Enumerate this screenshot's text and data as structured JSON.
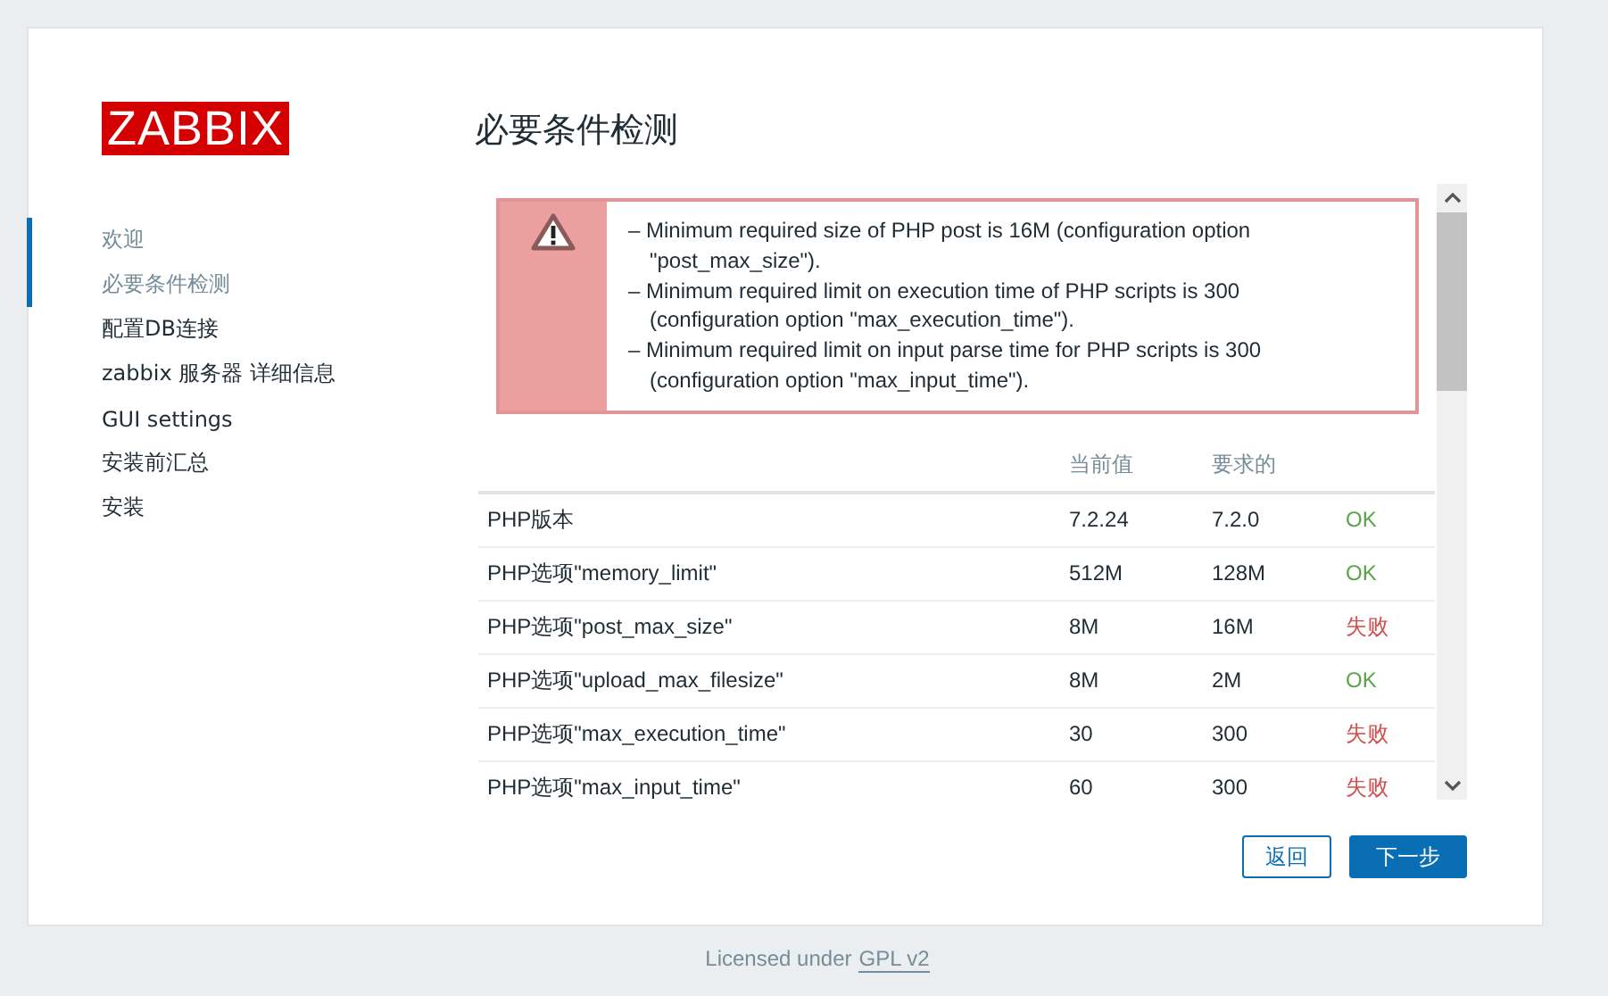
{
  "logo": "ZABBIX",
  "steps": [
    {
      "label": "欢迎",
      "done": true
    },
    {
      "label": "必要条件检测",
      "done": true
    },
    {
      "label": "配置DB连接",
      "done": false
    },
    {
      "label": "zabbix 服务器 详细信息",
      "done": false
    },
    {
      "label": "GUI settings",
      "done": false
    },
    {
      "label": "安装前汇总",
      "done": false
    },
    {
      "label": "安装",
      "done": false
    }
  ],
  "title": "必要条件检测",
  "alert": {
    "messages": [
      "– Minimum required size of PHP post is 16M (configuration option \"post_max_size\").",
      "– Minimum required limit on execution time of PHP scripts is 300 (configuration option \"max_execution_time\").",
      "– Minimum required limit on input parse time for PHP scripts is 300 (configuration option \"max_input_time\")."
    ]
  },
  "table": {
    "columns": [
      "当前值",
      "要求的"
    ],
    "rows": [
      {
        "name": "PHP版本",
        "current": "7.2.24",
        "required": "7.2.0",
        "result": "OK",
        "passed": true
      },
      {
        "name": "PHP选项\"memory_limit\"",
        "current": "512M",
        "required": "128M",
        "result": "OK",
        "passed": true
      },
      {
        "name": "PHP选项\"post_max_size\"",
        "current": "8M",
        "required": "16M",
        "result": "失败",
        "passed": false
      },
      {
        "name": "PHP选项\"upload_max_filesize\"",
        "current": "8M",
        "required": "2M",
        "result": "OK",
        "passed": true
      },
      {
        "name": "PHP选项\"max_execution_time\"",
        "current": "30",
        "required": "300",
        "result": "失败",
        "passed": false
      },
      {
        "name": "PHP选项\"max_input_time\"",
        "current": "60",
        "required": "300",
        "result": "失败",
        "passed": false
      }
    ]
  },
  "buttons": {
    "back": "返回",
    "next": "下一步"
  },
  "footer": {
    "text": "Licensed under",
    "link": "GPL v2"
  }
}
